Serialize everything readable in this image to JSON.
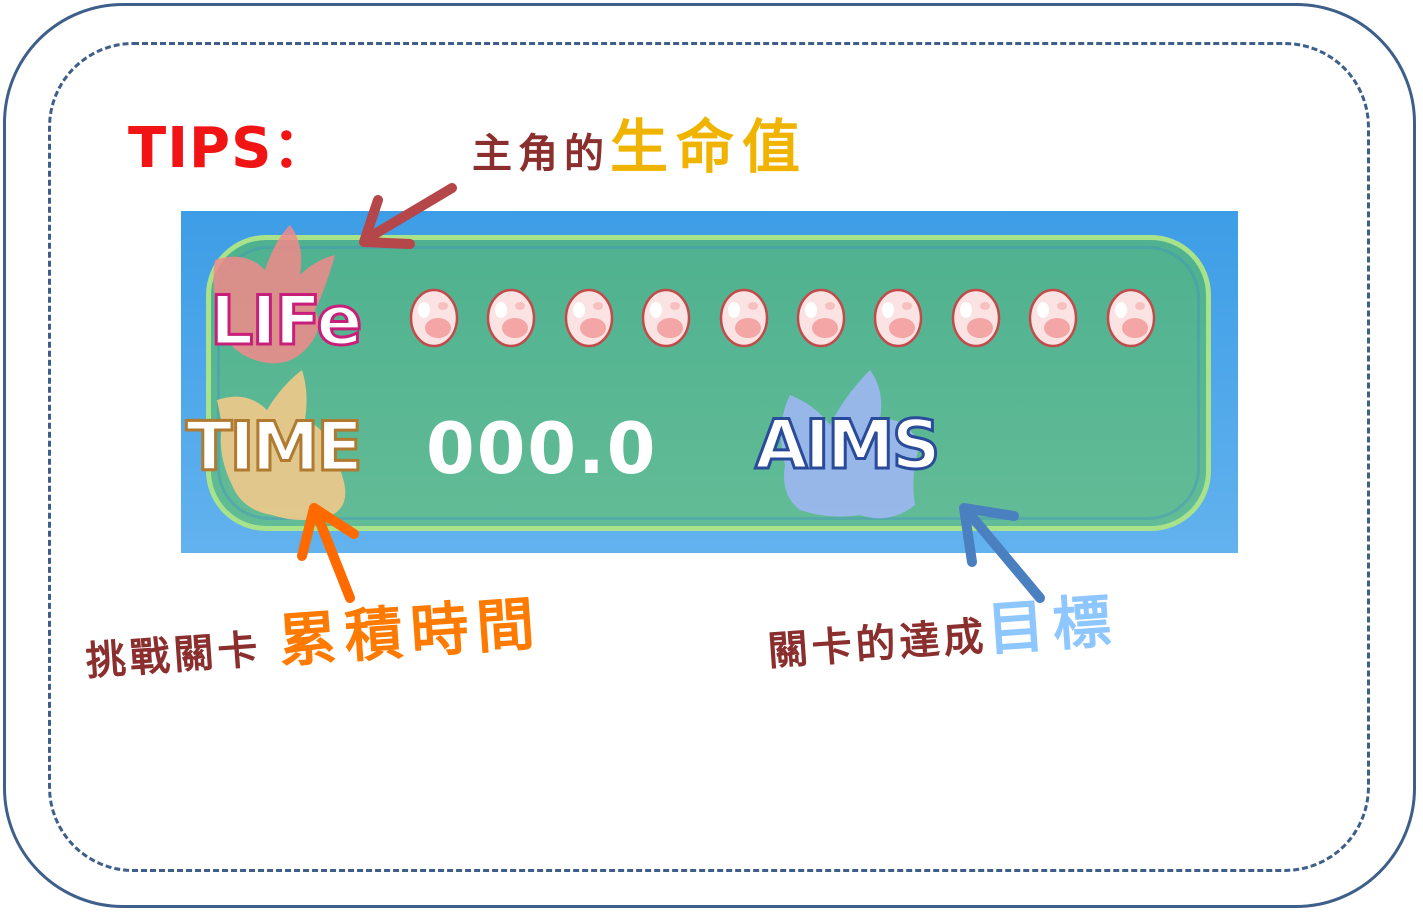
{
  "tips_label": "TIPS：",
  "notes": {
    "life_prefix": "主角的",
    "life_highlight": "生命值",
    "time_prefix": "挑戰關卡",
    "time_highlight": "累積時間",
    "aims_prefix": "關卡的達成",
    "aims_highlight": "目標"
  },
  "hud": {
    "life_label": "LIFe",
    "time_label": "TIME",
    "time_value": "000.0",
    "aims_label": "AIMS",
    "life_count": 10
  },
  "colors": {
    "border": "#3d5f8a",
    "tips": "#f01414",
    "note_text": "#8b2e2e",
    "life_highlight": "#f0b400",
    "time_highlight": "#ff7a00",
    "aims_highlight": "#8ec6ff",
    "arrow_life": "#b5464a",
    "arrow_time": "#ff6a00",
    "arrow_aims": "#4a7fc0"
  }
}
